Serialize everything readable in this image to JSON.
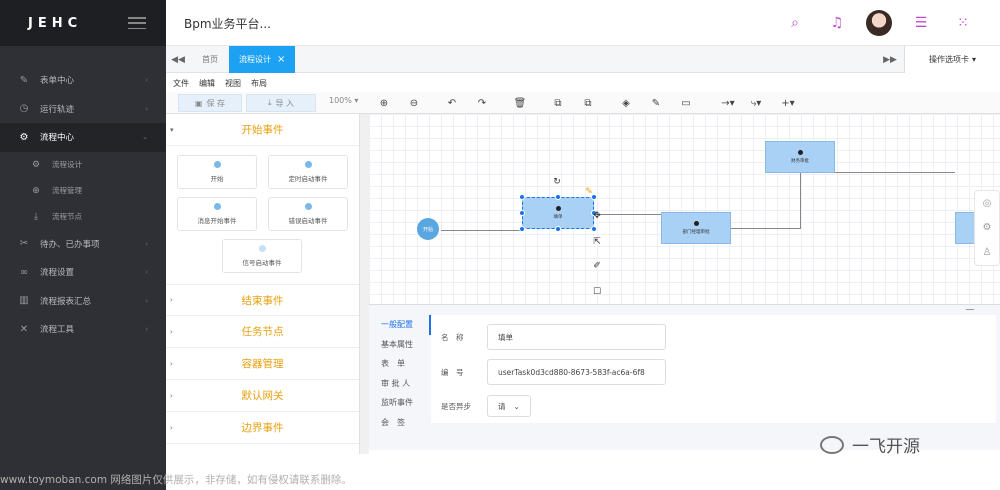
{
  "sidebar": {
    "logo": "JEHC",
    "items": [
      {
        "label": "表单中心",
        "icon": "form-icon"
      },
      {
        "label": "运行轨迹",
        "icon": "clock-icon"
      },
      {
        "label": "流程中心",
        "icon": "gear-icon"
      },
      {
        "label": "流程设计",
        "icon": "gears-icon"
      },
      {
        "label": "流程管理",
        "icon": "crosshair-icon"
      },
      {
        "label": "流程节点",
        "icon": "download-icon"
      },
      {
        "label": "待办、已办事项",
        "icon": "tools-icon"
      },
      {
        "label": "流程设置",
        "icon": "link-icon"
      },
      {
        "label": "流程报表汇总",
        "icon": "chart-icon"
      },
      {
        "label": "流程工具",
        "icon": "wrench-icon"
      }
    ]
  },
  "header": {
    "title": "Bpm业务平台..."
  },
  "tabs": {
    "home": "首页",
    "active": "流程设计",
    "operations": "操作选项卡"
  },
  "menu": [
    "文件",
    "编辑",
    "视图",
    "布局"
  ],
  "toolbar": {
    "save": "保 存",
    "import": "导 入",
    "zoom": "100%"
  },
  "palette": {
    "start_header": "开始事件",
    "items": [
      "开始",
      "定时启动事件",
      "消息开始事件",
      "错误启动事件",
      "信号启动事件"
    ],
    "sections": [
      "结束事件",
      "任务节点",
      "容器管理",
      "默认网关",
      "边界事件"
    ]
  },
  "canvas": {
    "start_label": "开始",
    "task1": "填单",
    "task2": "部门经理审批",
    "task3": "财务审批"
  },
  "props": {
    "tabs": [
      "一般配置",
      "基本属性",
      "表　单",
      "审 批 人",
      "监听事件",
      "会　签"
    ],
    "name_label": "名　称",
    "name_value": "填单",
    "id_label": "编　号",
    "id_value": "userTask0d3cd880-8673-583f-ac6a-6f8",
    "async_label": "是否异步",
    "async_value": "请"
  },
  "watermark": "www.toymoban.com 网络图片仅供展示，非存储，如有侵权请联系删除。",
  "brand": "一飞开源"
}
